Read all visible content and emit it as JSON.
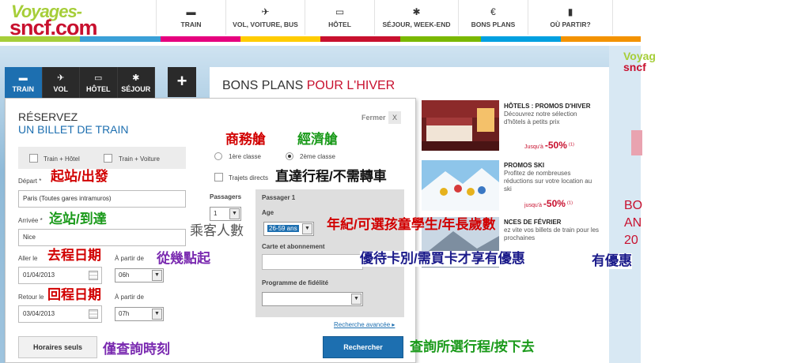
{
  "header": {
    "logo_line1": "Voyages-",
    "logo_line2": "sncf.com",
    "nav": [
      {
        "label": "TRAIN",
        "icon": "train-icon",
        "glyph": "▬"
      },
      {
        "label": "VOL, VOITURE, BUS",
        "icon": "plane-icon",
        "glyph": "✈"
      },
      {
        "label": "HÔTEL",
        "icon": "bed-icon",
        "glyph": "▭"
      },
      {
        "label": "SÉJOUR, WEEK-END",
        "icon": "palm-icon",
        "glyph": "✱"
      },
      {
        "label": "BONS PLANS",
        "icon": "euro-icon",
        "glyph": "€"
      },
      {
        "label": "OÙ PARTIR?",
        "icon": "suitcase-icon",
        "glyph": "▮"
      }
    ],
    "strip_colors": [
      "#a6ce39",
      "#3aa0d8",
      "#e6007e",
      "#ffcc00",
      "#c8102e",
      "#7ab800",
      "#00a0e0",
      "#f39200"
    ]
  },
  "tabs": [
    {
      "label": "TRAIN",
      "icon": "train-icon",
      "glyph": "▬",
      "active": true
    },
    {
      "label": "VOL",
      "icon": "plane-icon",
      "glyph": "✈",
      "active": false
    },
    {
      "label": "HÔTEL",
      "icon": "bed-icon",
      "glyph": "▭",
      "active": false
    },
    {
      "label": "SÉJOUR",
      "icon": "palm-icon",
      "glyph": "✱",
      "active": false
    }
  ],
  "plus_label": "+",
  "promo": {
    "title_a": "BONS PLANS ",
    "title_b": "POUR L'HIVER",
    "items": [
      {
        "title": "HÔTELS : PROMOS D'HIVER",
        "text": "Découvrez notre sélection d'hôtels à petits prix",
        "price_prefix": "Jusqu'à",
        "price": "-50%",
        "note": "(1)"
      },
      {
        "title": "PROMOS SKI",
        "text": "Profitez de nombreuses réductions sur votre location au ski",
        "price_prefix": "jusqu'à",
        "price": "-50%",
        "note": "(1)"
      },
      {
        "title": "NCES DE FÉVRIER",
        "text": "ez vite vos billets de train pour les prochaines"
      }
    ]
  },
  "side": {
    "logo_a": "Voyag",
    "logo_b": "sncf",
    "promo_lines": [
      "BO",
      "AN",
      "20"
    ]
  },
  "form": {
    "title_line1": "RÉSERVEZ",
    "title_line2": "UN BILLET DE TRAIN",
    "close_label": "Fermer",
    "close_x": "X",
    "opt_train_hotel": "Train + Hôtel",
    "opt_train_voiture": "Train + Voiture",
    "class_first": "1ère classe",
    "class_second": "2ème classe",
    "direct_label": "Trajets directs",
    "depart_label": "Départ *",
    "depart_value": "Paris (Toutes gares intramuros)",
    "arrivee_label": "Arrivée *",
    "arrivee_value": "Nice",
    "aller_label": "Aller le",
    "aller_value": "01/04/2013",
    "aller_time_label": "À partir de",
    "aller_time": "06h",
    "retour_label": "Retour le",
    "retour_value": "03/04/2013",
    "retour_time_label": "À partir de",
    "retour_time": "07h",
    "passagers_label": "Passagers",
    "passagers_value": "1",
    "pax_title": "Passager 1",
    "age_label": "Age",
    "age_value": "26-59 ans",
    "carte_label": "Carte et abonnement",
    "fidelite_label": "Programme de fidélité",
    "adv_link": "Recherche avancée ▸",
    "horaires_btn": "Horaires seuls",
    "search_btn": "Rechercher"
  },
  "annotations": {
    "business": "商務艙",
    "economy": "經濟艙",
    "direct": "直達行程/不需轉車",
    "origin": "起站/出發",
    "destination": "迄站/到達",
    "passengers": "乘客人數",
    "age": "年紀/可選孩童學生/年長歲數",
    "go_date": "去程日期",
    "from_time": "從幾點起",
    "card": "優待卡別/需買卡才享有優惠",
    "card_dup": "有優惠",
    "return_date": "回程日期",
    "timetable": "僅查詢時刻",
    "search": "查詢所選行程/按下去"
  }
}
